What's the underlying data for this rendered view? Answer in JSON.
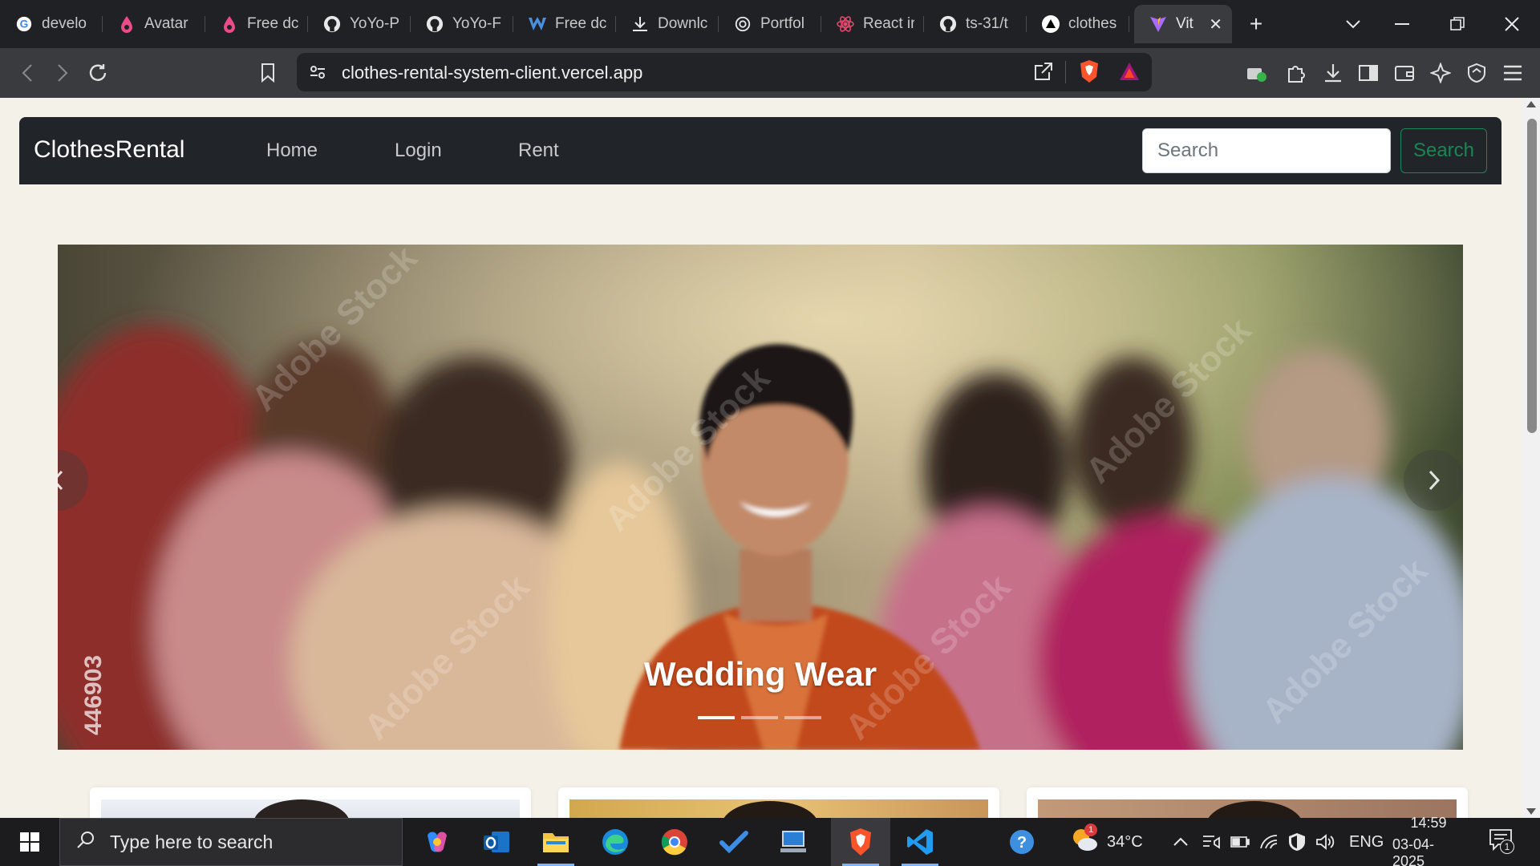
{
  "browser": {
    "tabs": [
      {
        "title": "develo",
        "icon": "google-icon"
      },
      {
        "title": "Avatar",
        "icon": "dribbble-icon"
      },
      {
        "title": "Free dc",
        "icon": "dribbble-icon"
      },
      {
        "title": "YoYo-P",
        "icon": "github-icon"
      },
      {
        "title": "YoYo-F",
        "icon": "github-icon"
      },
      {
        "title": "Free dc",
        "icon": "webflow-icon"
      },
      {
        "title": "Downlc",
        "icon": "download-icon"
      },
      {
        "title": "Portfol",
        "icon": "openai-icon"
      },
      {
        "title": "React ir",
        "icon": "react-icon"
      },
      {
        "title": "ts-31/t",
        "icon": "github-icon"
      },
      {
        "title": "clothes",
        "icon": "vercel-icon"
      }
    ],
    "active_tab": {
      "title": "Vit",
      "icon": "vite-icon"
    },
    "url": "clothes-rental-system-client.vercel.app"
  },
  "site": {
    "brand": "ClothesRental",
    "nav": {
      "home": "Home",
      "login": "Login",
      "rent": "Rent"
    },
    "search": {
      "placeholder": "Search",
      "button": "Search"
    },
    "carousel": {
      "caption": "Wedding Wear",
      "watermark_number": "446903",
      "slide_count": 3,
      "active_index": 0
    }
  },
  "taskbar": {
    "search_placeholder": "Type here to search",
    "weather": {
      "temperature": "34°C",
      "badge": "1"
    },
    "language": "ENG",
    "time": "14:59",
    "date": "03-04-2025",
    "notification_count": "1"
  },
  "colors": {
    "page_bg": "#f4f1e8",
    "navbar_bg": "#212529",
    "search_button": "#198754",
    "browser_dark": "#202124"
  }
}
